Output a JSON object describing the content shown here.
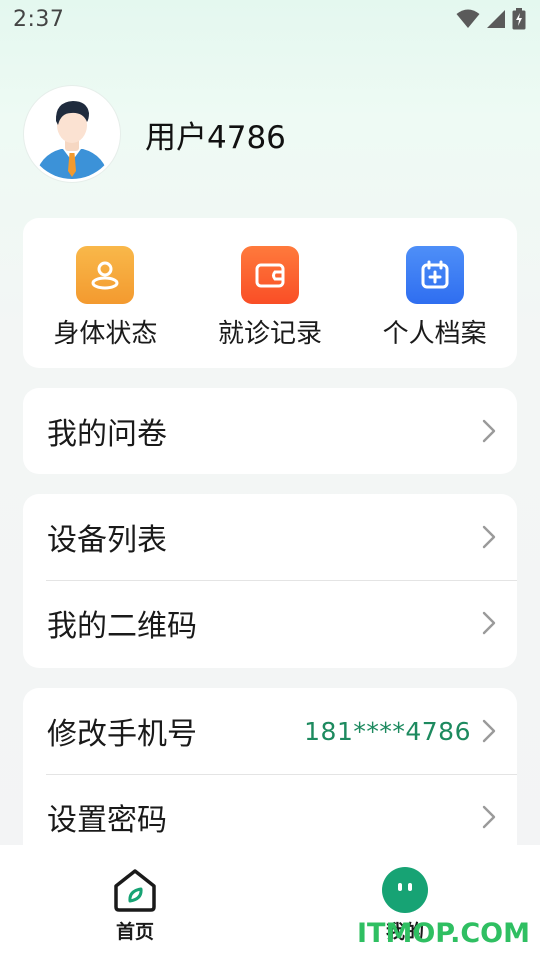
{
  "status_bar": {
    "time": "2:37",
    "icons": [
      "wifi-icon",
      "signal-icon",
      "battery-icon"
    ]
  },
  "profile": {
    "username": "用户4786",
    "avatar": "avatar-icon"
  },
  "quick_actions": [
    {
      "label": "身体状态",
      "icon": "person-icon",
      "color": "#f5a63a"
    },
    {
      "label": "就诊记录",
      "icon": "wallet-icon",
      "color": "#fb5a2b"
    },
    {
      "label": "个人档案",
      "icon": "calendar-plus-icon",
      "color": "#3f7ef5"
    }
  ],
  "menu": {
    "questionnaire": "我的问卷",
    "device_list": "设备列表",
    "qr_code": "我的二维码",
    "change_phone": "修改手机号",
    "phone_value": "181****4786",
    "set_password": "设置密码"
  },
  "tab_bar": {
    "home_label": "首页",
    "mine_label": "我的",
    "accent": "#17a374"
  },
  "watermark": "ITMOP.COM"
}
